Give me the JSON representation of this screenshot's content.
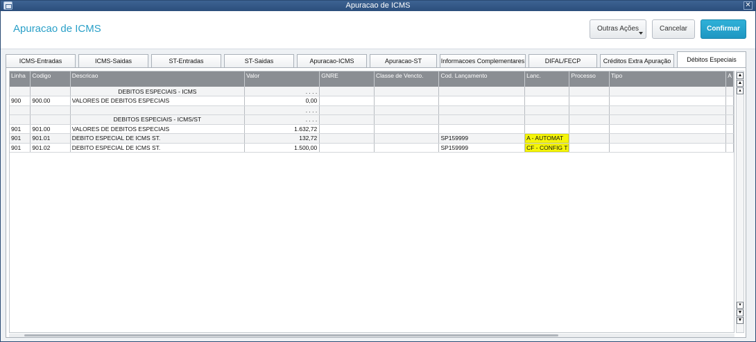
{
  "window": {
    "title": "Apuracao de ICMS"
  },
  "header": {
    "title": "Apuracao de ICMS",
    "outras_label": "Outras Ações",
    "cancelar_label": "Cancelar",
    "confirmar_label": "Confirmar"
  },
  "tabs": [
    {
      "label": "ICMS-Entradas"
    },
    {
      "label": "ICMS-Saidas"
    },
    {
      "label": "ST-Entradas"
    },
    {
      "label": "ST-Saidas"
    },
    {
      "label": "Apuracao-ICMS"
    },
    {
      "label": "Apuracao-ST"
    },
    {
      "label": "Informacoes Complementares"
    },
    {
      "label": "DIFAL/FECP"
    },
    {
      "label": "Créditos Extra Apuração"
    },
    {
      "label": "Débitos Especiais"
    }
  ],
  "active_tab": "Débitos Especiais",
  "grid": {
    "columns": [
      "Linha",
      "Codigo",
      "Descricao",
      "Valor",
      "GNRE",
      "Classe de Vencto.",
      "Cod. Lançamento",
      "Lanc.",
      "Processo",
      "Tipo",
      "A"
    ],
    "rows": [
      {
        "linha": "",
        "codigo": "",
        "descricao": "DEBITOS ESPECIAIS - ICMS",
        "valor": ". . . .",
        "gnre": "",
        "classe": "",
        "cod_lanc": "",
        "lanc": "",
        "processo": "",
        "tipo": ""
      },
      {
        "linha": "900",
        "codigo": "900.00",
        "descricao": "VALORES DE DEBITOS ESPECIAIS",
        "valor": "0,00",
        "gnre": "",
        "classe": "",
        "cod_lanc": "",
        "lanc": "",
        "processo": "",
        "tipo": ""
      },
      {
        "linha": "",
        "codigo": "",
        "descricao": "",
        "valor": ". . . .",
        "gnre": "",
        "classe": "",
        "cod_lanc": "",
        "lanc": "",
        "processo": "",
        "tipo": ""
      },
      {
        "linha": "",
        "codigo": "",
        "descricao": "DEBITOS ESPECIAIS - ICMS/ST",
        "valor": ". . . .",
        "gnre": "",
        "classe": "",
        "cod_lanc": "",
        "lanc": "",
        "processo": "",
        "tipo": ""
      },
      {
        "linha": "901",
        "codigo": "901.00",
        "descricao": "VALORES DE DEBITOS ESPECIAIS",
        "valor": "1.632,72",
        "gnre": "",
        "classe": "",
        "cod_lanc": "",
        "lanc": "",
        "processo": "",
        "tipo": ""
      },
      {
        "linha": "901",
        "codigo": "901.01",
        "descricao": "DEBITO ESPECIAL DE ICMS ST.",
        "valor": "132,72",
        "gnre": "",
        "classe": "",
        "cod_lanc": "SP159999",
        "lanc": "A  - AUTOMAT",
        "processo": "",
        "tipo": ""
      },
      {
        "linha": "901",
        "codigo": "901.02",
        "descricao": "DEBITO ESPECIAL DE ICMS ST.",
        "valor": "1.500,00",
        "gnre": "",
        "classe": "",
        "cod_lanc": "SP159999",
        "lanc": "CF - CONFIG T",
        "processo": "",
        "tipo": ""
      }
    ]
  },
  "colors": {
    "accent": "#2aa0c8",
    "header_bg": "#8a8e93",
    "highlight": "#f5f50a"
  }
}
